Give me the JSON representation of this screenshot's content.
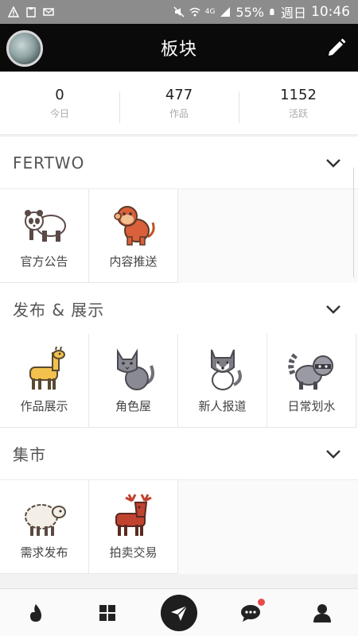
{
  "status_bar": {
    "battery": "55%",
    "day": "週日",
    "time": "10:46",
    "network": "4G"
  },
  "header": {
    "title": "板块"
  },
  "stats": [
    {
      "value": "0",
      "label": "今日"
    },
    {
      "value": "477",
      "label": "作品"
    },
    {
      "value": "1152",
      "label": "活跃"
    }
  ],
  "sections": [
    {
      "title": "FERTWO",
      "items": [
        {
          "label": "官方公告",
          "icon": "panda-icon"
        },
        {
          "label": "内容推送",
          "icon": "monkey-icon"
        }
      ]
    },
    {
      "title": "发布 & 展示",
      "items": [
        {
          "label": "作品展示",
          "icon": "llama-icon"
        },
        {
          "label": "角色屋",
          "icon": "cat-icon"
        },
        {
          "label": "新人报道",
          "icon": "husky-icon"
        },
        {
          "label": "日常划水",
          "icon": "raccoon-icon"
        }
      ]
    },
    {
      "title": "集市",
      "items": [
        {
          "label": "需求发布",
          "icon": "sheep-icon"
        },
        {
          "label": "拍卖交易",
          "icon": "moose-icon"
        }
      ]
    }
  ],
  "bottom_nav": [
    "flame-icon",
    "grid-icon",
    "send-icon",
    "chat-icon",
    "profile-icon"
  ],
  "colors": {
    "accent": "#d9603a",
    "header_bg": "#0a0a0a",
    "badge": "#e84a4a"
  }
}
